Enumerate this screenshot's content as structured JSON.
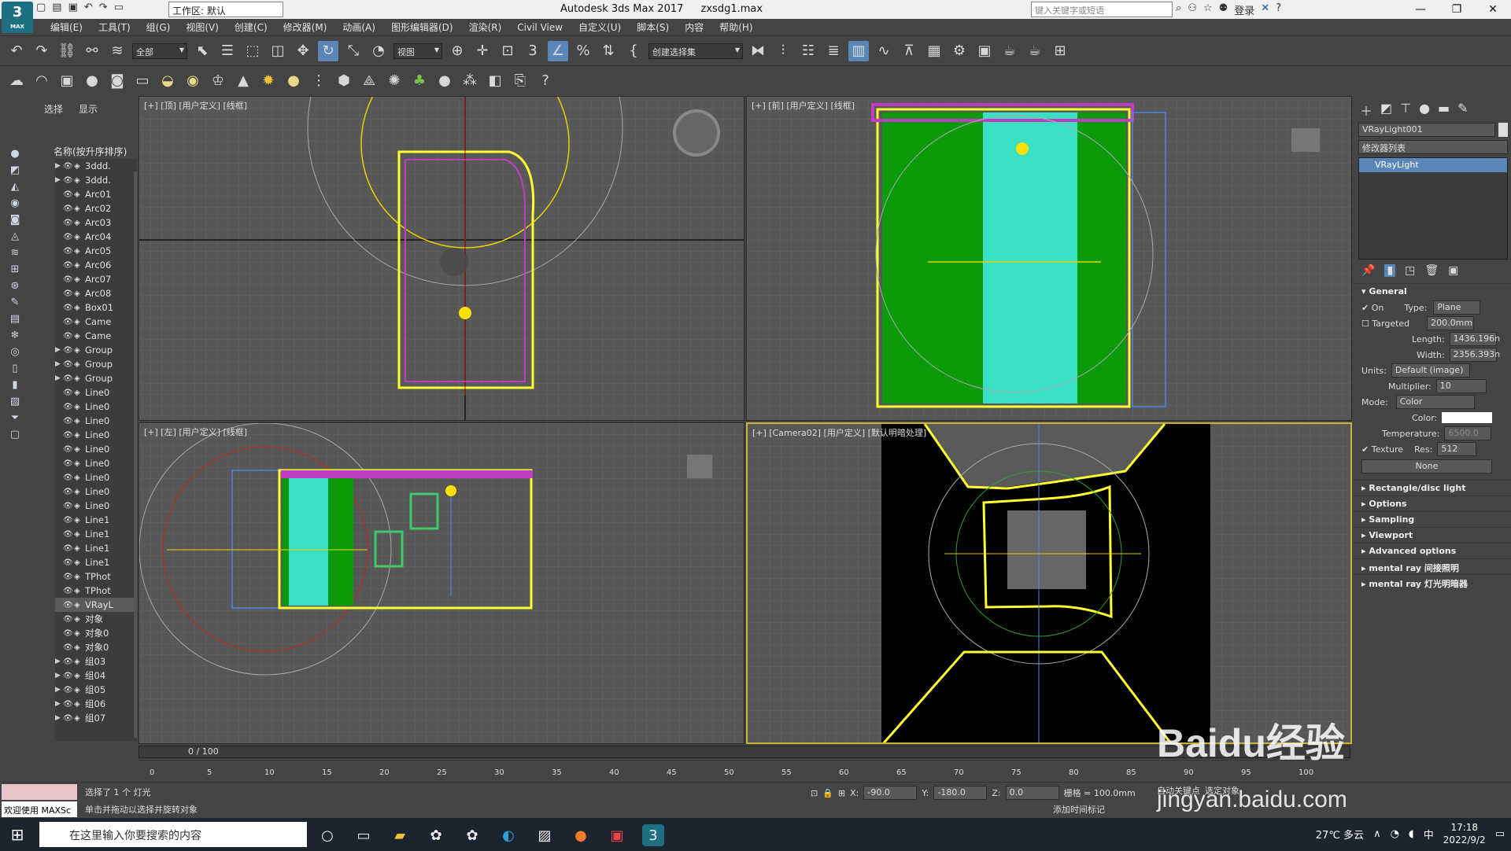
{
  "title": {
    "app": "Autodesk 3ds Max 2017",
    "file": "zxsdg1.max",
    "workspace": "工作区: 默认",
    "search_placeholder": "键入关键字或短语",
    "login": "登录",
    "logo_text": "3",
    "logo_sub": "MAX"
  },
  "menu": [
    "编辑(E)",
    "工具(T)",
    "组(G)",
    "视图(V)",
    "创建(C)",
    "修改器(M)",
    "动画(A)",
    "图形编辑器(D)",
    "渲染(R)",
    "Civil View",
    "自定义(U)",
    "脚本(S)",
    "内容",
    "帮助(H)"
  ],
  "toolbar": {
    "filter": "全部",
    "ref_coord": "视图",
    "selection_set": "创建选择集"
  },
  "scene_explorer": {
    "tab_select": "选择",
    "tab_display": "显示",
    "header": "名称(按升序排序)",
    "items": [
      {
        "name": "3ddd.",
        "exp": true
      },
      {
        "name": "3ddd.",
        "exp": true
      },
      {
        "name": "Arc01",
        "exp": false
      },
      {
        "name": "Arc02",
        "exp": false
      },
      {
        "name": "Arc03",
        "exp": false
      },
      {
        "name": "Arc04",
        "exp": false
      },
      {
        "name": "Arc05",
        "exp": false
      },
      {
        "name": "Arc06",
        "exp": false
      },
      {
        "name": "Arc07",
        "exp": false
      },
      {
        "name": "Arc08",
        "exp": false
      },
      {
        "name": "Box01",
        "exp": false
      },
      {
        "name": "Came",
        "exp": false
      },
      {
        "name": "Came",
        "exp": false
      },
      {
        "name": "Group",
        "exp": true
      },
      {
        "name": "Group",
        "exp": true
      },
      {
        "name": "Group",
        "exp": true
      },
      {
        "name": "Line0",
        "exp": false
      },
      {
        "name": "Line0",
        "exp": false
      },
      {
        "name": "Line0",
        "exp": false
      },
      {
        "name": "Line0",
        "exp": false
      },
      {
        "name": "Line0",
        "exp": false
      },
      {
        "name": "Line0",
        "exp": false
      },
      {
        "name": "Line0",
        "exp": false
      },
      {
        "name": "Line0",
        "exp": false
      },
      {
        "name": "Line0",
        "exp": false
      },
      {
        "name": "Line1",
        "exp": false
      },
      {
        "name": "Line1",
        "exp": false
      },
      {
        "name": "Line1",
        "exp": false
      },
      {
        "name": "Line1",
        "exp": false
      },
      {
        "name": "TPhot",
        "exp": false
      },
      {
        "name": "TPhot",
        "exp": false
      },
      {
        "name": "VRayL",
        "exp": false,
        "selected": true
      },
      {
        "name": "对象",
        "exp": false
      },
      {
        "name": "对象0",
        "exp": false
      },
      {
        "name": "对象0",
        "exp": false
      },
      {
        "name": "组03",
        "exp": true
      },
      {
        "name": "组04",
        "exp": true
      },
      {
        "name": "组05",
        "exp": true
      },
      {
        "name": "组06",
        "exp": true
      },
      {
        "name": "组07",
        "exp": true
      }
    ]
  },
  "viewports": {
    "top": "[+] [顶] [用户定义] [线框]",
    "front": "[+] [前] [用户定义] [线框]",
    "left": "[+] [左] [用户定义] [线框]",
    "camera": "[+] [Camera02] [用户定义] [默认明暗处理]"
  },
  "command_panel": {
    "object_name": "VRayLight001",
    "modifier_list": "修改器列表",
    "stack_item": "VRayLight",
    "general": "General",
    "on_label": "On",
    "type_label": "Type:",
    "type_value": "Plane",
    "targeted_label": "Targeted",
    "targeted_value": "200.0mm",
    "length_label": "Length:",
    "length_value": "1436.196n",
    "width_label": "Width:",
    "width_value": "2356.393n",
    "units_label": "Units:",
    "units_value": "Default (image)",
    "multiplier_label": "Multiplier:",
    "multiplier_value": "10",
    "mode_label": "Mode:",
    "mode_value": "Color",
    "color_label": "Color:",
    "temperature_label": "Temperature:",
    "temperature_value": "6500.0",
    "texture_label": "Texture",
    "res_label": "Res:",
    "res_value": "512",
    "none_button": "None",
    "rollouts": [
      "Rectangle/disc light",
      "Options",
      "Sampling",
      "Viewport",
      "Advanced options",
      "mental ray 间接照明",
      "mental ray 灯光明暗器"
    ]
  },
  "timeline": {
    "frame": "0 / 100",
    "ticks": [
      "0",
      "5",
      "10",
      "15",
      "20",
      "25",
      "30",
      "35",
      "40",
      "45",
      "50",
      "55",
      "60",
      "65",
      "70",
      "75",
      "80",
      "85",
      "90",
      "95",
      "100"
    ]
  },
  "status": {
    "welcome": "欢迎使用 MAXSc",
    "selected": "选择了 1 个 灯光",
    "prompt": "单击并拖动以选择并旋转对象",
    "x_label": "X:",
    "x_value": "-90.0",
    "y_label": "Y:",
    "y_value": "-180.0",
    "z_label": "Z:",
    "z_value": "0.0",
    "grid": "栅格 = 100.0mm",
    "add_time_tag": "添加时间标记",
    "auto_key": "自动关键点",
    "selected_obj": "选定对象"
  },
  "taskbar": {
    "search": "在这里输入你要搜索的内容",
    "weather": "27℃ 多云",
    "ime": "中",
    "time": "17:18",
    "date": "2022/9/2"
  },
  "watermark": {
    "brand": "Baidu经验",
    "url": "jingyan.baidu.com"
  }
}
